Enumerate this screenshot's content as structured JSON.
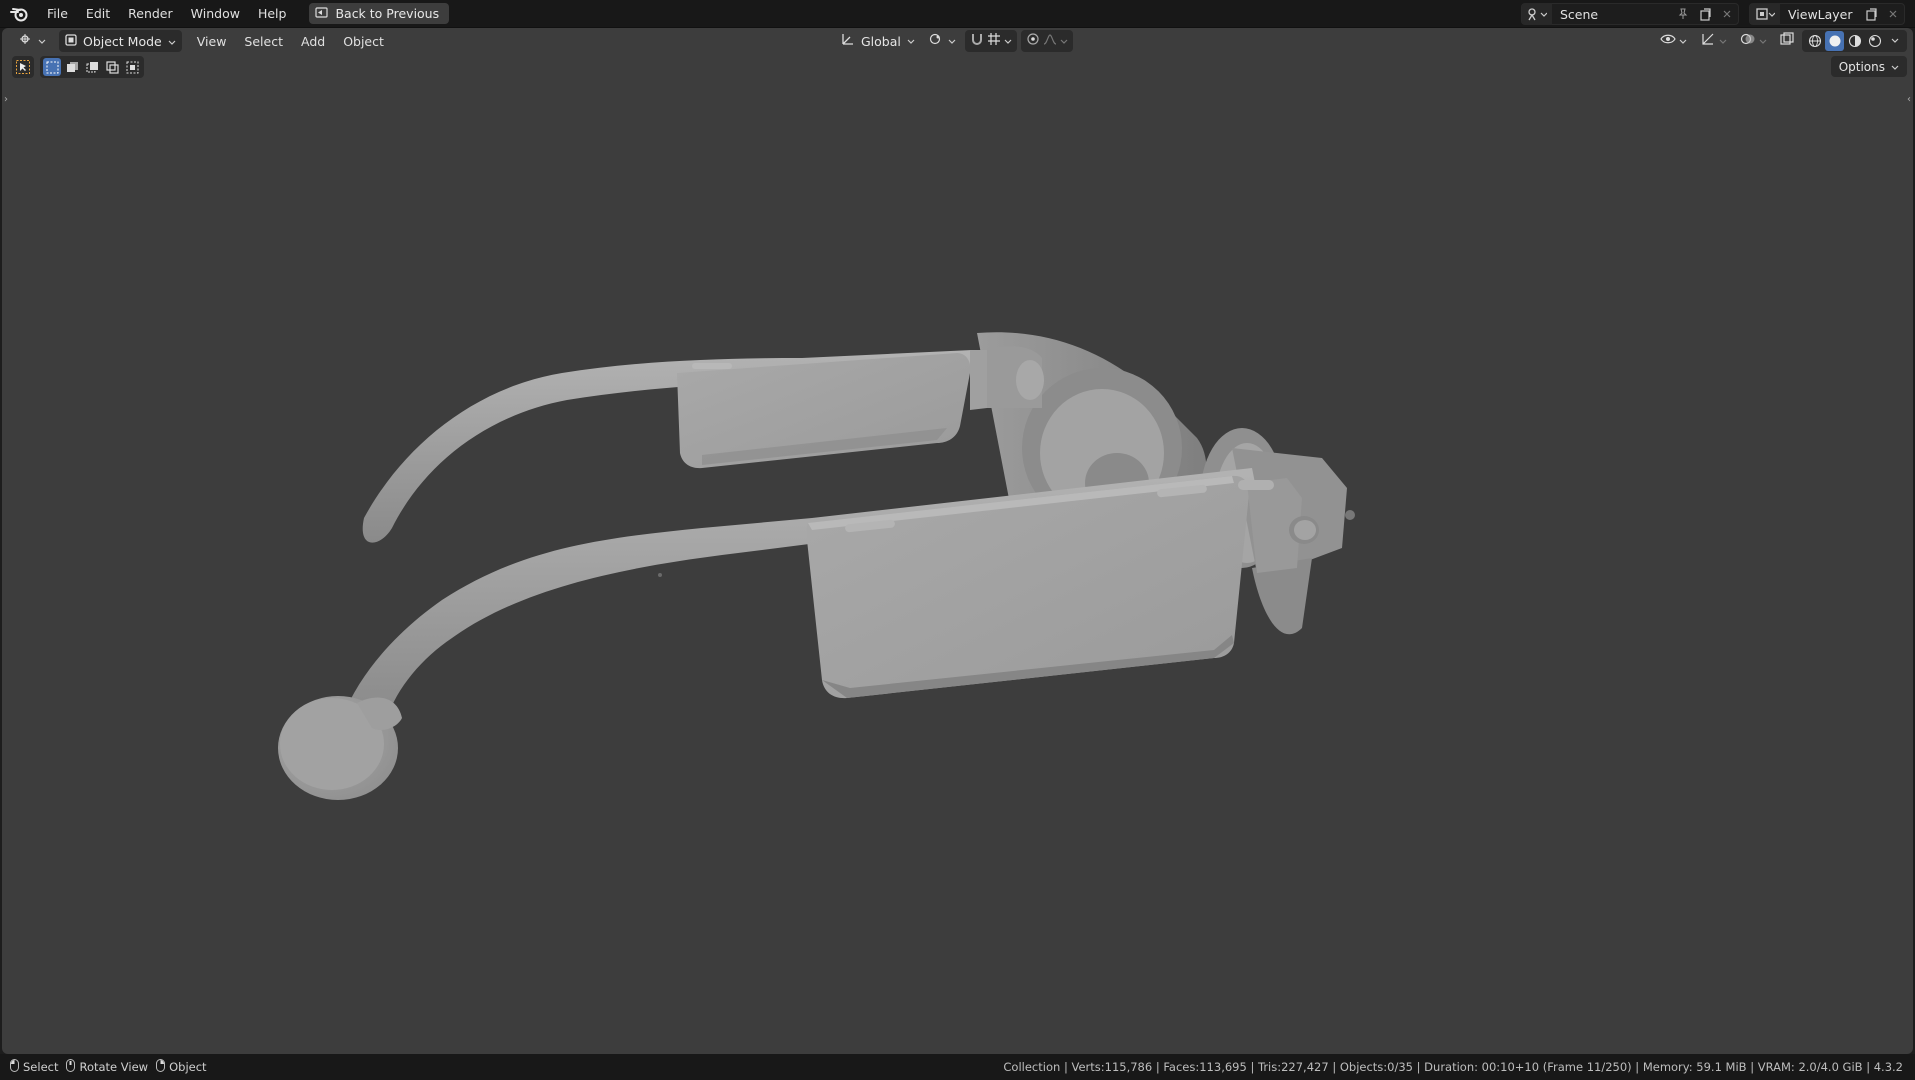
{
  "menubar": {
    "items": [
      {
        "label": "File"
      },
      {
        "label": "Edit"
      },
      {
        "label": "Render"
      },
      {
        "label": "Window"
      },
      {
        "label": "Help"
      }
    ],
    "back_button": "Back to Previous",
    "scene": "Scene",
    "view_layer": "ViewLayer"
  },
  "viewport_header": {
    "mode": "Object Mode",
    "menus": [
      {
        "label": "View"
      },
      {
        "label": "Select"
      },
      {
        "label": "Add"
      },
      {
        "label": "Object"
      }
    ],
    "transform_orientation": "Global",
    "options_label": "Options",
    "active_shading": "solid"
  },
  "statusbar": {
    "hints": [
      {
        "label": "Select"
      },
      {
        "label": "Rotate View"
      },
      {
        "label": "Object"
      }
    ],
    "info": "Collection | Verts:115,786 | Faces:113,695 | Tris:227,427 | Objects:0/35 | Duration: 00:10+10 (Frame 11/250) | Memory: 59.1 MiB | VRAM: 2.0/4.0 GiB | 4.3.2"
  },
  "colors": {
    "viewport_bg": "#3d3d3d",
    "header_bg": "#181818",
    "accent": "#4772b3",
    "model_gray": "#a6a6a6"
  }
}
